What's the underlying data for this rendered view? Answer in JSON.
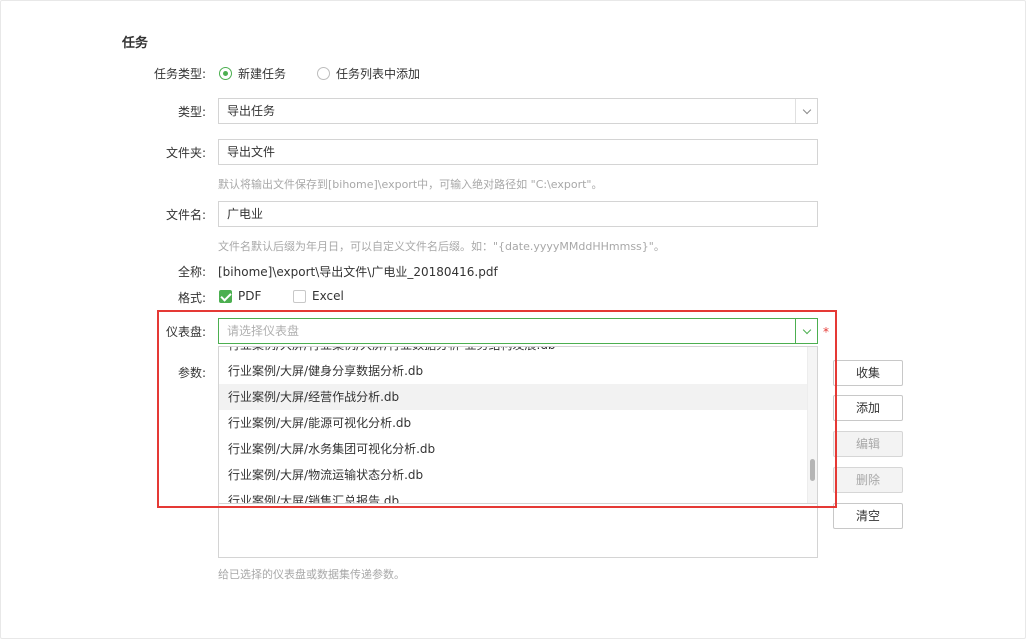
{
  "section": {
    "title": "任务"
  },
  "task_type": {
    "label": "任务类型:",
    "options": [
      {
        "label": "新建任务",
        "selected": true
      },
      {
        "label": "任务列表中添加",
        "selected": false
      }
    ]
  },
  "type": {
    "label": "类型:",
    "value": "导出任务"
  },
  "folder": {
    "label": "文件夹:",
    "value": "导出文件",
    "hint": "默认将输出文件保存到[bihome]\\export中，可输入绝对路径如 \"C:\\export\"。"
  },
  "filename": {
    "label": "文件名:",
    "value": "广电业",
    "hint": "文件名默认后缀为年月日，可以自定义文件名后缀。如：\"{date.yyyyMMddHHmmss}\"。"
  },
  "fullname": {
    "label": "全称:",
    "value": "[bihome]\\export\\导出文件\\广电业_20180416.pdf"
  },
  "format": {
    "label": "格式:",
    "options": [
      {
        "label": "PDF",
        "checked": true
      },
      {
        "label": "Excel",
        "checked": false
      }
    ]
  },
  "dashboard": {
    "label": "仪表盘:",
    "placeholder": "请选择仪表盘",
    "required_mark": "*",
    "items": [
      "行业案例/大屏/行业案例/大屏/行业数据分析-业务结构发展.db",
      "行业案例/大屏/健身分享数据分析.db",
      "行业案例/大屏/经营作战分析.db",
      "行业案例/大屏/能源可视化分析.db",
      "行业案例/大屏/水务集团可视化分析.db",
      "行业案例/大屏/物流运输状态分析.db",
      "行业案例/大屏/销售汇总报告.db"
    ],
    "hovered_index": 2
  },
  "params": {
    "label": "参数:",
    "hint": "给已选择的仪表盘或数据集传递参数。",
    "buttons": {
      "collect": "收集",
      "add": "添加",
      "edit": "编辑",
      "delete": "删除",
      "clear": "清空"
    }
  },
  "colors": {
    "accent": "#4caf50",
    "highlight": "#e53935"
  }
}
